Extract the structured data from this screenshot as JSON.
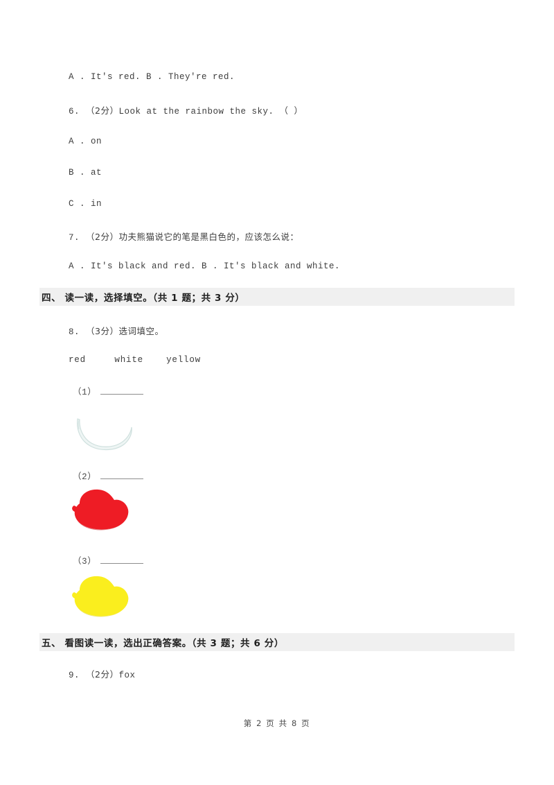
{
  "document": {
    "type": "english-exam-worksheet",
    "page_background": "#ffffff"
  },
  "questions": [
    {
      "id": "q5-options",
      "options_line": "A . It's red.      B . They're red."
    },
    {
      "id": "q6",
      "number": "6.",
      "score": "（2分）",
      "stem": "Look at the rainbow          the sky.   （    ）",
      "options": [
        "A . on",
        "B . at",
        "C . in"
      ]
    },
    {
      "id": "q7",
      "number": "7.",
      "score": "（2分）",
      "stem": "功夫熊猫说它的笔是黑白色的，应该怎么说：",
      "options_line": "A . It's black and red.     B . It's black and white."
    }
  ],
  "sections": [
    {
      "id": "section-four",
      "label": "四、 读一读，选择填空。（共 1 题；共 3 分）"
    },
    {
      "id": "section-five",
      "label": "五、 看图读一读，选出正确答案。（共 3 题；共 6 分）"
    }
  ],
  "question8": {
    "number": "8.",
    "score": "（3分）",
    "stem": "选词填空。",
    "word_bank": "red     white    yellow",
    "items": [
      {
        "label": "（1）",
        "image": "white-paint-blob",
        "color": "#ffffff",
        "outline": "#cfe0de"
      },
      {
        "label": "（2）",
        "image": "red-paint-blob",
        "color": "#ee1c25",
        "outline": "#d01119"
      },
      {
        "label": "（3）",
        "image": "yellow-paint-blob",
        "color": "#faee1e",
        "outline": "#e2d514"
      }
    ]
  },
  "question9": {
    "number": "9.",
    "score": "（2分）",
    "stem": "fox"
  },
  "footer": {
    "text": "第 2 页 共 8 页"
  }
}
